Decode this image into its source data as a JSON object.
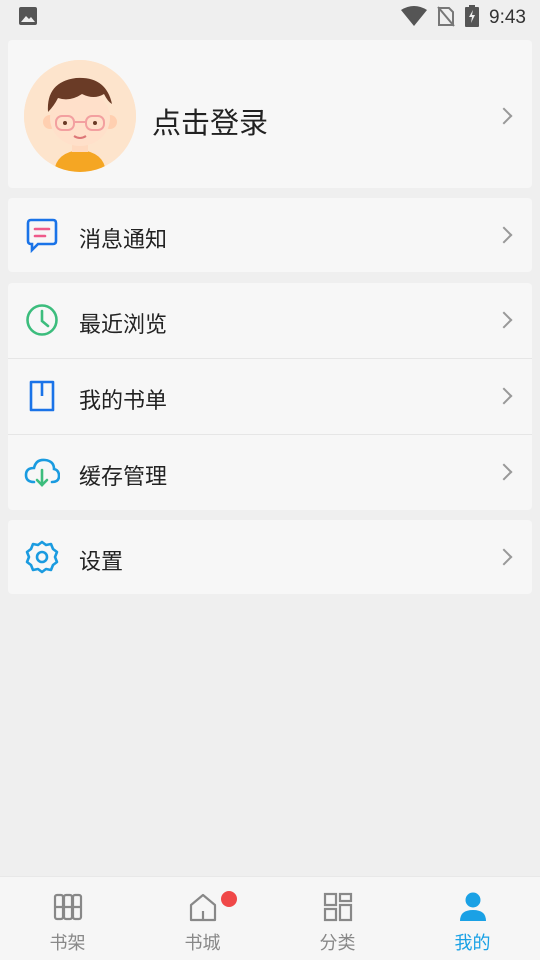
{
  "status_bar": {
    "time": "9:43",
    "icons": [
      "image-icon",
      "wifi-icon",
      "no-sim-icon",
      "battery-charging-icon"
    ]
  },
  "profile": {
    "login_label": "点击登录",
    "avatar": "cartoon-boy-avatar"
  },
  "menu_groups": [
    {
      "items": [
        {
          "label": "消息通知",
          "icon": "message-icon"
        }
      ]
    },
    {
      "items": [
        {
          "label": "最近浏览",
          "icon": "clock-icon"
        },
        {
          "label": "我的书单",
          "icon": "book-list-icon"
        },
        {
          "label": "缓存管理",
          "icon": "cloud-download-icon"
        }
      ]
    },
    {
      "items": [
        {
          "label": "设置",
          "icon": "gear-icon"
        }
      ]
    }
  ],
  "tabs": [
    {
      "label": "书架",
      "icon": "bookshelf-icon",
      "active": false
    },
    {
      "label": "书城",
      "icon": "home-icon",
      "active": false,
      "badge": true
    },
    {
      "label": "分类",
      "icon": "grid-icon",
      "active": false
    },
    {
      "label": "我的",
      "icon": "user-icon",
      "active": true
    }
  ],
  "colors": {
    "accent": "#1aa1e5",
    "badge": "#f04848",
    "message_icon": "#1a73e8",
    "message_lines": "#ef5a8a",
    "clock_icon": "#3cbd7d",
    "book_icon": "#1a73e8",
    "cloud_icon": "#1a9be0",
    "gear_icon": "#1a9be0"
  }
}
